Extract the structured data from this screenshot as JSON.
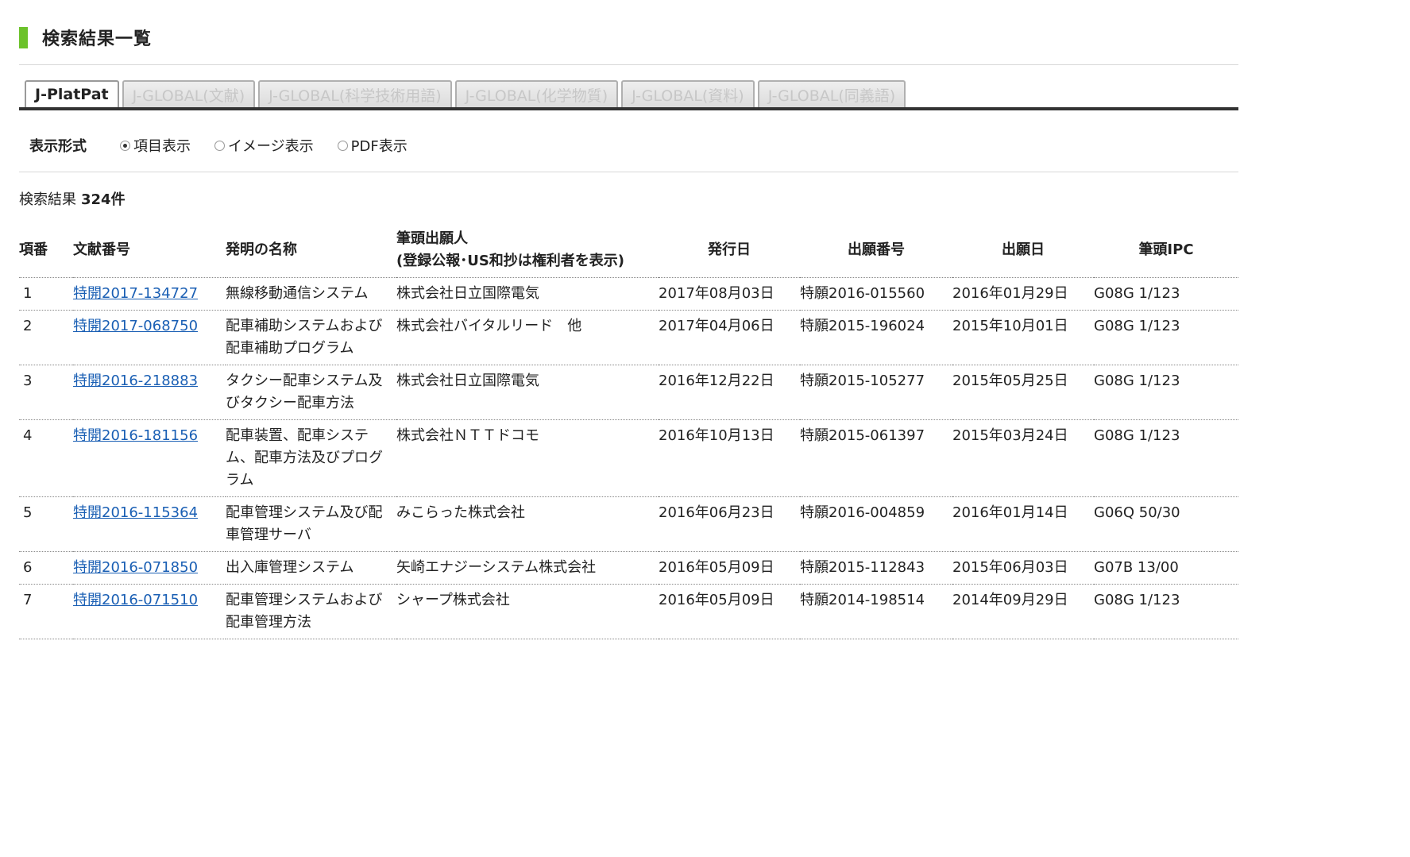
{
  "page_title": "検索結果一覧",
  "tabs": [
    {
      "label": "J-PlatPat",
      "active": true
    },
    {
      "label": "J-GLOBAL(文献)",
      "active": false
    },
    {
      "label": "J-GLOBAL(科学技術用語)",
      "active": false
    },
    {
      "label": "J-GLOBAL(化学物質)",
      "active": false
    },
    {
      "label": "J-GLOBAL(資料)",
      "active": false
    },
    {
      "label": "J-GLOBAL(同義語)",
      "active": false
    }
  ],
  "display": {
    "label": "表示形式",
    "options": [
      {
        "label": "項目表示",
        "checked": true
      },
      {
        "label": "イメージ表示",
        "checked": false
      },
      {
        "label": "PDF表示",
        "checked": false
      }
    ]
  },
  "results": {
    "count_label": "検索結果",
    "count_value": "324件"
  },
  "table": {
    "headers": {
      "no": "項番",
      "doc": "文献番号",
      "name": "発明の名称",
      "applicant_line1": "筆頭出願人",
      "applicant_line2": "(登録公報･US和抄は権利者を表示)",
      "pub_date": "発行日",
      "app_no": "出願番号",
      "app_date": "出願日",
      "ipc": "筆頭IPC"
    },
    "rows": [
      {
        "no": "1",
        "doc": "特開2017-134727",
        "name": "無線移動通信システム",
        "applicant": "株式会社日立国際電気",
        "pub_date": "2017年08月03日",
        "app_no": "特願2016-015560",
        "app_date": "2016年01月29日",
        "ipc": "G08G 1/123"
      },
      {
        "no": "2",
        "doc": "特開2017-068750",
        "name": "配車補助システムおよび配車補助プログラム",
        "applicant": "株式会社バイタルリード　他",
        "pub_date": "2017年04月06日",
        "app_no": "特願2015-196024",
        "app_date": "2015年10月01日",
        "ipc": "G08G 1/123"
      },
      {
        "no": "3",
        "doc": "特開2016-218883",
        "name": "タクシー配車システム及びタクシー配車方法",
        "applicant": "株式会社日立国際電気",
        "pub_date": "2016年12月22日",
        "app_no": "特願2015-105277",
        "app_date": "2015年05月25日",
        "ipc": "G08G 1/123"
      },
      {
        "no": "4",
        "doc": "特開2016-181156",
        "name": "配車装置、配車システム、配車方法及びプログラム",
        "applicant": "株式会社ＮＴＴドコモ",
        "pub_date": "2016年10月13日",
        "app_no": "特願2015-061397",
        "app_date": "2015年03月24日",
        "ipc": "G08G 1/123"
      },
      {
        "no": "5",
        "doc": "特開2016-115364",
        "name": "配車管理システム及び配車管理サーバ",
        "applicant": "みこらった株式会社",
        "pub_date": "2016年06月23日",
        "app_no": "特願2016-004859",
        "app_date": "2016年01月14日",
        "ipc": "G06Q 50/30"
      },
      {
        "no": "6",
        "doc": "特開2016-071850",
        "name": "出入庫管理システム",
        "applicant": "矢崎エナジーシステム株式会社",
        "pub_date": "2016年05月09日",
        "app_no": "特願2015-112843",
        "app_date": "2015年06月03日",
        "ipc": "G07B 13/00"
      },
      {
        "no": "7",
        "doc": "特開2016-071510",
        "name": "配車管理システムおよび配車管理方法",
        "applicant": "シャープ株式会社",
        "pub_date": "2016年05月09日",
        "app_no": "特願2014-198514",
        "app_date": "2014年09月29日",
        "ipc": "G08G 1/123"
      }
    ]
  },
  "colors": {
    "accent_bar": "#6cc22b",
    "link": "#1a5fb4",
    "tab_underline": "#333333"
  }
}
